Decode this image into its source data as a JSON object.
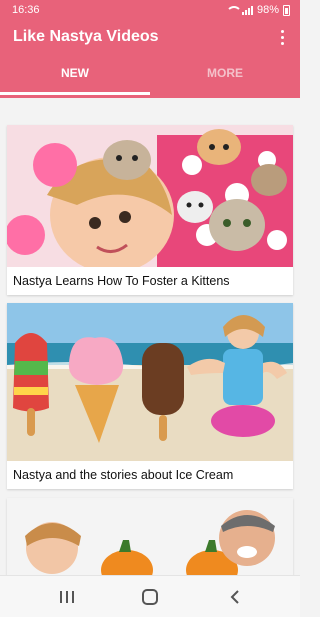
{
  "status_bar": {
    "time": "16:36",
    "battery": "98%"
  },
  "app": {
    "title": "Like Nastya Videos"
  },
  "tabs": [
    {
      "label": "NEW",
      "selected": true
    },
    {
      "label": "MORE",
      "selected": false
    }
  ],
  "videos": [
    {
      "title": "Nastya Learns How To Foster a Kittens"
    },
    {
      "title": "Nastya and the stories about Ice Cream"
    },
    {
      "title": ""
    }
  ],
  "colors": {
    "primary": "#e8627a",
    "tab_inactive": "#f4c1ca"
  },
  "icons": {
    "overflow": "more-vert",
    "nav_recent": "recent-apps",
    "nav_home": "home",
    "nav_back": "back"
  }
}
